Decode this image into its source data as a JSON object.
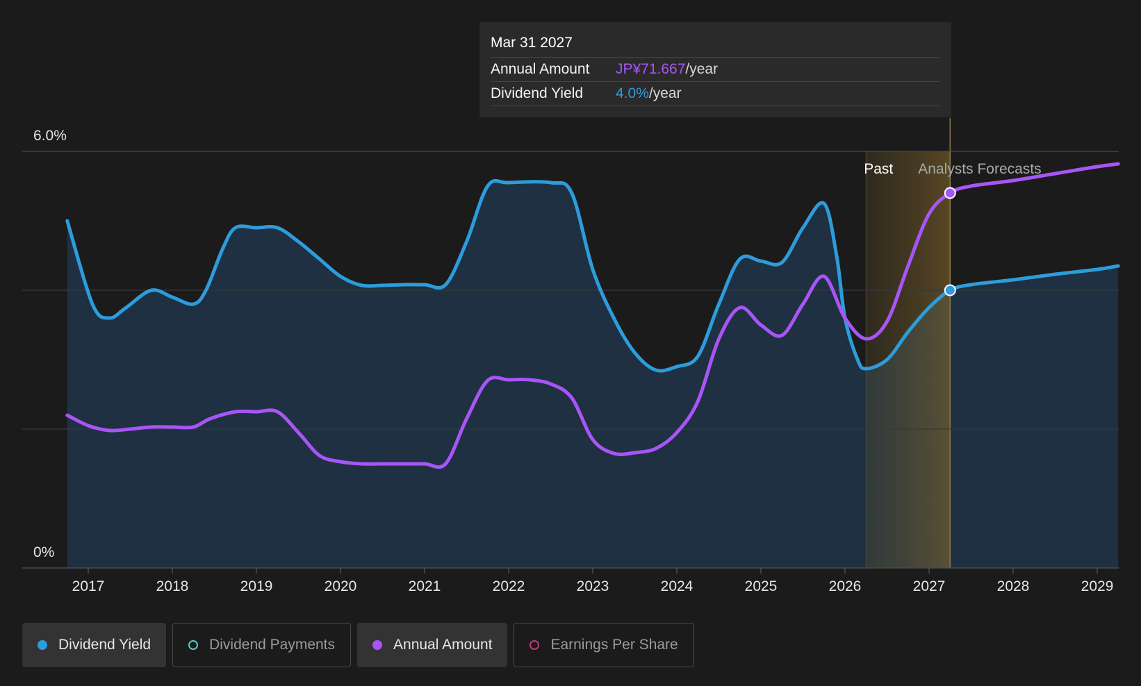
{
  "tooltip": {
    "date": "Mar 31 2027",
    "rows": [
      {
        "label": "Annual Amount",
        "value": "JP¥71.667",
        "unit": "/year",
        "color": "#a855f7"
      },
      {
        "label": "Dividend Yield",
        "value": "4.0%",
        "unit": "/year",
        "color": "#2d9cdb"
      }
    ]
  },
  "regions": {
    "past": "Past",
    "forecast": "Analysts Forecasts"
  },
  "legend": [
    {
      "label": "Dividend Yield",
      "color": "#2d9cdb",
      "active": true,
      "icon": "filled-dot"
    },
    {
      "label": "Dividend Payments",
      "color": "#4fd1c5",
      "active": false,
      "icon": "ring-dot"
    },
    {
      "label": "Annual Amount",
      "color": "#a855f7",
      "active": true,
      "icon": "filled-dot"
    },
    {
      "label": "Earnings Per Share",
      "color": "#c0397a",
      "active": false,
      "icon": "ring-dot"
    }
  ],
  "chart_data": {
    "type": "area",
    "xlim": [
      2016.75,
      2029.25
    ],
    "ylim": [
      0,
      6
    ],
    "y_ticks": [
      "6.0%",
      "0%"
    ],
    "x_ticks": [
      "2017",
      "2018",
      "2019",
      "2020",
      "2021",
      "2022",
      "2023",
      "2024",
      "2025",
      "2026",
      "2027",
      "2028",
      "2029"
    ],
    "past_end": 2026.25,
    "cursor_x": 2027.25,
    "series": [
      {
        "name": "Dividend Yield",
        "color": "#2d9cdb",
        "points": [
          [
            2016.75,
            5.0
          ],
          [
            2017.05,
            3.8
          ],
          [
            2017.25,
            3.6
          ],
          [
            2017.45,
            3.75
          ],
          [
            2017.75,
            4.0
          ],
          [
            2018.0,
            3.9
          ],
          [
            2018.25,
            3.8
          ],
          [
            2018.4,
            4.0
          ],
          [
            2018.6,
            4.6
          ],
          [
            2018.75,
            4.9
          ],
          [
            2019.0,
            4.9
          ],
          [
            2019.25,
            4.9
          ],
          [
            2019.5,
            4.7
          ],
          [
            2019.75,
            4.45
          ],
          [
            2020.0,
            4.2
          ],
          [
            2020.25,
            4.07
          ],
          [
            2020.5,
            4.07
          ],
          [
            2020.75,
            4.08
          ],
          [
            2021.0,
            4.08
          ],
          [
            2021.25,
            4.08
          ],
          [
            2021.5,
            4.7
          ],
          [
            2021.75,
            5.5
          ],
          [
            2022.0,
            5.55
          ],
          [
            2022.5,
            5.55
          ],
          [
            2022.75,
            5.4
          ],
          [
            2023.0,
            4.3
          ],
          [
            2023.25,
            3.6
          ],
          [
            2023.5,
            3.1
          ],
          [
            2023.75,
            2.85
          ],
          [
            2024.0,
            2.9
          ],
          [
            2024.25,
            3.05
          ],
          [
            2024.5,
            3.8
          ],
          [
            2024.75,
            4.45
          ],
          [
            2025.0,
            4.42
          ],
          [
            2025.25,
            4.4
          ],
          [
            2025.5,
            4.9
          ],
          [
            2025.75,
            5.25
          ],
          [
            2025.9,
            4.5
          ],
          [
            2026.0,
            3.6
          ],
          [
            2026.15,
            3.0
          ],
          [
            2026.25,
            2.87
          ],
          [
            2026.5,
            3.0
          ],
          [
            2026.75,
            3.4
          ],
          [
            2027.0,
            3.75
          ],
          [
            2027.25,
            4.0
          ],
          [
            2027.5,
            4.08
          ],
          [
            2028.0,
            4.15
          ],
          [
            2028.5,
            4.23
          ],
          [
            2029.0,
            4.3
          ],
          [
            2029.25,
            4.35
          ]
        ]
      },
      {
        "name": "Annual Amount",
        "color": "#a855f7",
        "points": [
          [
            2016.75,
            2.2
          ],
          [
            2017.0,
            2.05
          ],
          [
            2017.25,
            1.98
          ],
          [
            2017.5,
            2.0
          ],
          [
            2017.75,
            2.03
          ],
          [
            2018.0,
            2.03
          ],
          [
            2018.25,
            2.03
          ],
          [
            2018.45,
            2.15
          ],
          [
            2018.75,
            2.25
          ],
          [
            2019.0,
            2.25
          ],
          [
            2019.25,
            2.25
          ],
          [
            2019.5,
            1.95
          ],
          [
            2019.75,
            1.62
          ],
          [
            2020.0,
            1.53
          ],
          [
            2020.25,
            1.5
          ],
          [
            2020.5,
            1.5
          ],
          [
            2020.75,
            1.5
          ],
          [
            2021.0,
            1.5
          ],
          [
            2021.25,
            1.5
          ],
          [
            2021.5,
            2.15
          ],
          [
            2021.75,
            2.7
          ],
          [
            2022.0,
            2.71
          ],
          [
            2022.25,
            2.71
          ],
          [
            2022.5,
            2.65
          ],
          [
            2022.75,
            2.45
          ],
          [
            2023.0,
            1.85
          ],
          [
            2023.25,
            1.65
          ],
          [
            2023.5,
            1.66
          ],
          [
            2023.75,
            1.72
          ],
          [
            2024.0,
            1.95
          ],
          [
            2024.25,
            2.4
          ],
          [
            2024.5,
            3.3
          ],
          [
            2024.75,
            3.75
          ],
          [
            2025.0,
            3.5
          ],
          [
            2025.25,
            3.35
          ],
          [
            2025.5,
            3.8
          ],
          [
            2025.75,
            4.2
          ],
          [
            2026.0,
            3.6
          ],
          [
            2026.25,
            3.3
          ],
          [
            2026.5,
            3.55
          ],
          [
            2026.75,
            4.35
          ],
          [
            2027.0,
            5.1
          ],
          [
            2027.25,
            5.4
          ],
          [
            2027.5,
            5.5
          ],
          [
            2028.0,
            5.58
          ],
          [
            2028.5,
            5.68
          ],
          [
            2029.0,
            5.78
          ],
          [
            2029.25,
            5.82
          ]
        ]
      }
    ]
  }
}
